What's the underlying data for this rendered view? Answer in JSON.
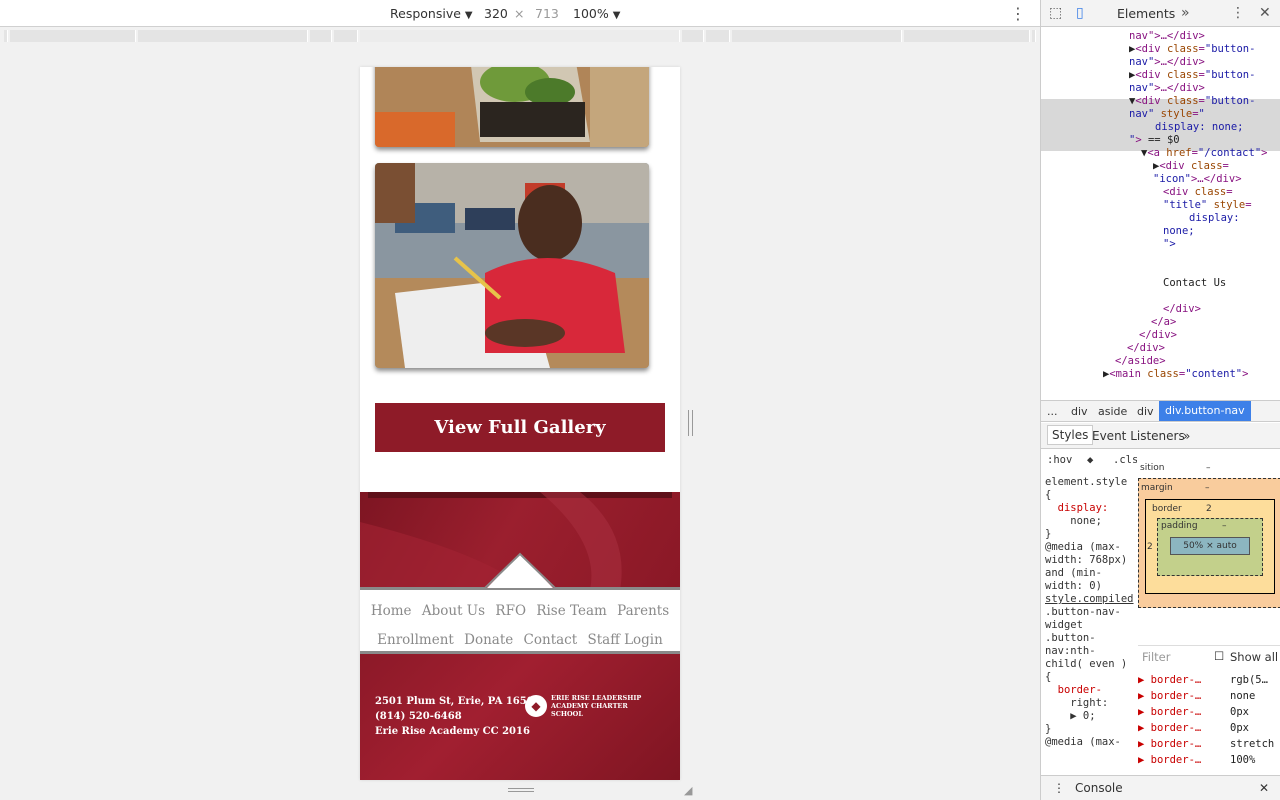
{
  "device_toolbar": {
    "device": "Responsive",
    "width": "320",
    "height": "713",
    "zoom": "100%",
    "times": "×"
  },
  "page": {
    "gallery_button": "View Full Gallery",
    "nav_row1": [
      "Home",
      "About Us",
      "RFO",
      "Rise Team",
      "Parents"
    ],
    "nav_row2": [
      "Enrollment",
      "Donate",
      "Contact",
      "Staff Login"
    ],
    "address": "2501 Plum St, Erie, PA 16502",
    "phone": "(814) 520-6468",
    "copyright": "Erie Rise Academy CC 2016",
    "logo_text": "Erie Rise Leadership Academy Charter School"
  },
  "devtools": {
    "tab": "Elements",
    "dom_lines": [
      {
        "indent": 88,
        "parts": [
          [
            "tag",
            "nav\">…</div>"
          ]
        ]
      },
      {
        "indent": 88,
        "parts": [
          [
            "txt",
            "▶"
          ],
          [
            "tag",
            "<div "
          ],
          [
            "attr",
            "class"
          ],
          [
            "tag",
            "="
          ],
          [
            "val",
            "\"button-"
          ]
        ]
      },
      {
        "indent": 88,
        "parts": [
          [
            "val",
            "nav\""
          ],
          [
            "tag",
            ">…</div>"
          ]
        ]
      },
      {
        "indent": 88,
        "parts": [
          [
            "txt",
            "▶"
          ],
          [
            "tag",
            "<div "
          ],
          [
            "attr",
            "class"
          ],
          [
            "tag",
            "="
          ],
          [
            "val",
            "\"button-"
          ]
        ]
      },
      {
        "indent": 88,
        "parts": [
          [
            "val",
            "nav\""
          ],
          [
            "tag",
            ">…</div>"
          ]
        ]
      },
      {
        "indent": 88,
        "parts": [
          [
            "txt",
            "▼"
          ],
          [
            "tag",
            "<div "
          ],
          [
            "attr",
            "class"
          ],
          [
            "tag",
            "="
          ],
          [
            "val",
            "\"button-"
          ]
        ]
      },
      {
        "indent": 88,
        "parts": [
          [
            "val",
            "nav\" "
          ],
          [
            "attr",
            "style"
          ],
          [
            "tag",
            "="
          ],
          [
            "val",
            "\""
          ]
        ]
      },
      {
        "indent": 114,
        "parts": [
          [
            "val",
            "display: none;"
          ]
        ]
      },
      {
        "indent": 88,
        "parts": [
          [
            "val",
            "\""
          ],
          [
            "tag",
            ">"
          ],
          [
            "txt",
            " == $0"
          ]
        ]
      },
      {
        "indent": 100,
        "parts": [
          [
            "txt",
            "▼"
          ],
          [
            "tag",
            "<a "
          ],
          [
            "attr",
            "href"
          ],
          [
            "tag",
            "="
          ],
          [
            "val",
            "\"/contact\""
          ],
          [
            "tag",
            ">"
          ]
        ]
      },
      {
        "indent": 112,
        "parts": [
          [
            "txt",
            "▶"
          ],
          [
            "tag",
            "<div "
          ],
          [
            "attr",
            "class"
          ],
          [
            "tag",
            "="
          ]
        ]
      },
      {
        "indent": 112,
        "parts": [
          [
            "val",
            "\"icon\""
          ],
          [
            "tag",
            ">…</div>"
          ]
        ]
      },
      {
        "indent": 122,
        "parts": [
          [
            "tag",
            "<div "
          ],
          [
            "attr",
            "class"
          ],
          [
            "tag",
            "="
          ]
        ]
      },
      {
        "indent": 122,
        "parts": [
          [
            "val",
            "\"title\" "
          ],
          [
            "attr",
            "style"
          ],
          [
            "tag",
            "="
          ]
        ]
      },
      {
        "indent": 148,
        "parts": [
          [
            "val",
            "display:"
          ]
        ]
      },
      {
        "indent": 122,
        "parts": [
          [
            "val",
            "none;"
          ]
        ]
      },
      {
        "indent": 122,
        "parts": [
          [
            "val",
            "\">"
          ]
        ]
      },
      {
        "indent": 122,
        "parts": [
          [
            "txt",
            ""
          ]
        ]
      },
      {
        "indent": 122,
        "parts": [
          [
            "txt",
            ""
          ]
        ]
      },
      {
        "indent": 122,
        "parts": [
          [
            "txt",
            "Contact Us"
          ]
        ]
      },
      {
        "indent": 122,
        "parts": [
          [
            "txt",
            ""
          ]
        ]
      },
      {
        "indent": 122,
        "parts": [
          [
            "tag",
            "</div>"
          ]
        ]
      },
      {
        "indent": 110,
        "parts": [
          [
            "tag",
            "</a>"
          ]
        ]
      },
      {
        "indent": 98,
        "parts": [
          [
            "tag",
            "</div>"
          ]
        ]
      },
      {
        "indent": 86,
        "parts": [
          [
            "tag",
            "</div>"
          ]
        ]
      },
      {
        "indent": 74,
        "parts": [
          [
            "tag",
            "</aside>"
          ]
        ]
      },
      {
        "indent": 62,
        "parts": [
          [
            "txt",
            "▶"
          ],
          [
            "tag",
            "<main "
          ],
          [
            "attr",
            "class"
          ],
          [
            "tag",
            "="
          ],
          [
            "val",
            "\"content\""
          ],
          [
            "tag",
            ">"
          ]
        ]
      }
    ],
    "breadcrumbs": [
      "...",
      "div",
      "aside",
      "div",
      "div.button-nav"
    ],
    "styles_tabs": [
      "Styles",
      "Event Listeners"
    ],
    "styles_toolbar": [
      ":hov",
      ".cls"
    ],
    "styles_lines": [
      "element.style",
      "{",
      "  display:",
      "    none;",
      "}",
      "@media (max-",
      "width: 768px)",
      "and (min-",
      "width: 0)",
      "style.compiled",
      ".button-nav-",
      "widget",
      ".button-",
      "nav:nth-",
      "child( even )",
      "{",
      "  border-",
      "    right:",
      "    ▶ 0;",
      "}",
      "@media (max-"
    ],
    "box_model": {
      "position_label": "sition",
      "margin": "margin",
      "border": "border",
      "border_value": "2",
      "padding": "padding",
      "content": "50% × auto",
      "side_border": "2",
      "dash": "–"
    },
    "filter_placeholder": "Filter",
    "show_all": "Show all",
    "computed": [
      {
        "k": "border-…",
        "v": "rgb(5…"
      },
      {
        "k": "border-…",
        "v": "none"
      },
      {
        "k": "border-…",
        "v": "0px"
      },
      {
        "k": "border-…",
        "v": "0px"
      },
      {
        "k": "border-…",
        "v": "stretch"
      },
      {
        "k": "border-…",
        "v": "100%"
      }
    ],
    "console_tab": "Console"
  }
}
